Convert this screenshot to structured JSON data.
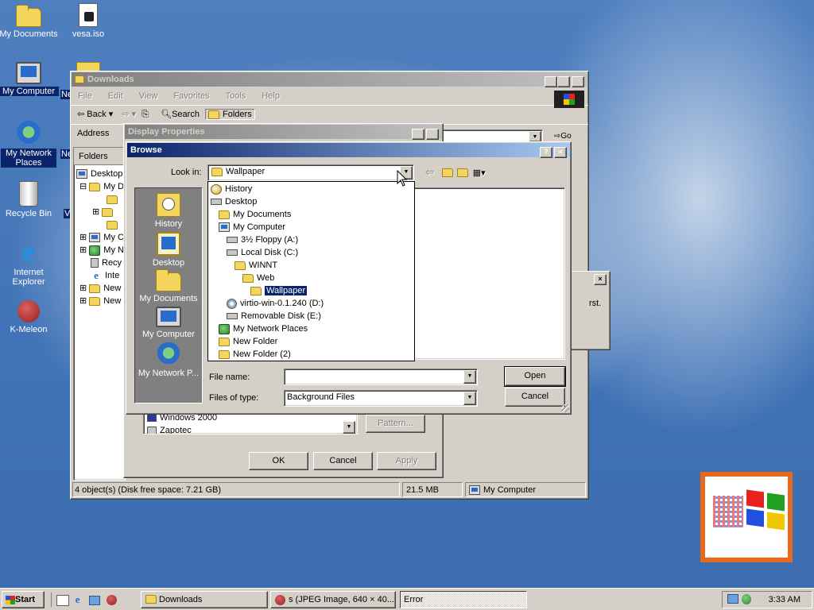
{
  "desktop": {
    "icons": [
      {
        "label": "My Documents",
        "icon": "my-documents-icon"
      },
      {
        "label": "vesa.iso",
        "icon": "iso-file-icon"
      },
      {
        "label": "My Computer",
        "icon": "my-computer-icon"
      },
      {
        "label": "My Network Places",
        "icon": "network-places-icon"
      },
      {
        "label": "Recycle Bin",
        "icon": "recycle-bin-icon"
      },
      {
        "label": "Internet Explorer",
        "icon": "internet-explorer-icon"
      },
      {
        "label": "K-Meleon",
        "icon": "k-meleon-icon"
      }
    ],
    "partial_labels": {
      "ne1": "Ne",
      "ne2": "Ne",
      "vi": "Vi"
    }
  },
  "explorer": {
    "title": "Downloads",
    "menu": [
      "File",
      "Edit",
      "View",
      "Favorites",
      "Tools",
      "Help"
    ],
    "toolbar": {
      "back": "Back",
      "search": "Search",
      "folders": "Folders"
    },
    "address_label": "Address",
    "go_label": "Go",
    "folders_pane_title": "Folders",
    "tree": [
      "Desktop",
      "My D",
      "",
      "",
      "",
      "My C",
      "My N",
      "Recy",
      "Inte",
      "New",
      "New"
    ],
    "status": {
      "objects": "4 object(s) (Disk free space: 7.21 GB)",
      "size": "21.5 MB",
      "zone": "My Computer"
    }
  },
  "display_properties": {
    "title": "Display Properties",
    "wallpaper_item": "Windows 2000",
    "wallpaper_item_partial": "Zapotec",
    "pattern_button": "Pattern...",
    "ok": "OK",
    "cancel": "Cancel",
    "apply": "Apply"
  },
  "error_dialog": {
    "text_partial": "rst."
  },
  "browse": {
    "title": "Browse",
    "look_in_label": "Look in:",
    "look_in_value": "Wallpaper",
    "dropdown_items": [
      {
        "label": "History",
        "indent": 0,
        "icon": "history"
      },
      {
        "label": "Desktop",
        "indent": 0,
        "icon": "desktop"
      },
      {
        "label": "My Documents",
        "indent": 1,
        "icon": "folder"
      },
      {
        "label": "My Computer",
        "indent": 1,
        "icon": "computer"
      },
      {
        "label": "3½ Floppy (A:)",
        "indent": 2,
        "icon": "drive"
      },
      {
        "label": "Local Disk (C:)",
        "indent": 2,
        "icon": "drive"
      },
      {
        "label": "WINNT",
        "indent": 3,
        "icon": "folder"
      },
      {
        "label": "Web",
        "indent": 4,
        "icon": "folder"
      },
      {
        "label": "Wallpaper",
        "indent": 5,
        "icon": "folder-open",
        "selected": true
      },
      {
        "label": "virtio-win-0.1.240 (D:)",
        "indent": 2,
        "icon": "cd"
      },
      {
        "label": "Removable Disk (E:)",
        "indent": 2,
        "icon": "drive"
      },
      {
        "label": "My Network Places",
        "indent": 1,
        "icon": "network"
      },
      {
        "label": "New Folder",
        "indent": 1,
        "icon": "folder"
      },
      {
        "label": "New Folder (2)",
        "indent": 1,
        "icon": "folder"
      }
    ],
    "places": [
      {
        "label": "History",
        "icon": "history-icon"
      },
      {
        "label": "Desktop",
        "icon": "desktop-icon"
      },
      {
        "label": "My Documents",
        "icon": "my-documents-icon"
      },
      {
        "label": "My Computer",
        "icon": "my-computer-icon"
      },
      {
        "label": "My Network P...",
        "icon": "network-places-icon"
      }
    ],
    "file_name_label": "File name:",
    "file_name_value": "",
    "file_type_label": "Files of type:",
    "file_type_value": "Background Files",
    "open": "Open",
    "cancel": "Cancel"
  },
  "taskbar": {
    "start": "Start",
    "tasks": [
      {
        "label": "Downloads",
        "icon": "folder-icon",
        "pressed": false
      },
      {
        "label": "s (JPEG Image, 640 × 40...",
        "icon": "k-meleon-icon",
        "pressed": false
      },
      {
        "label": "Error",
        "icon": "none",
        "pressed": true
      }
    ],
    "clock": "3:33 AM"
  },
  "colors": {
    "title_active": "#0a246a",
    "title_gradient_end": "#a6caf0",
    "face": "#d4d0c8",
    "desktop": "#3f72b6"
  }
}
